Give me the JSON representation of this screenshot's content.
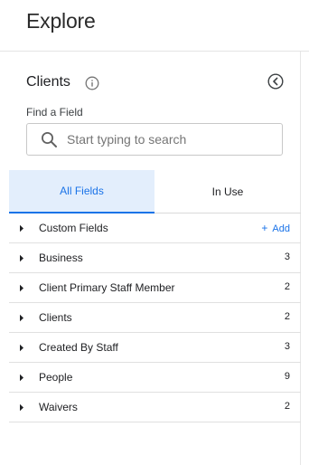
{
  "header": {
    "title": "Explore"
  },
  "panel": {
    "title": "Clients",
    "find_label": "Find a Field",
    "search": {
      "placeholder": "Start typing to search",
      "value": ""
    }
  },
  "tabs": [
    {
      "label": "All Fields",
      "active": true
    },
    {
      "label": "In Use",
      "active": false
    }
  ],
  "fields": [
    {
      "label": "Custom Fields",
      "action": "+ Add",
      "action_plus": "+",
      "action_label": "Add"
    },
    {
      "label": "Business",
      "count": "3"
    },
    {
      "label": "Client Primary Staff Member",
      "count": "2"
    },
    {
      "label": "Clients",
      "count": "2"
    },
    {
      "label": "Created By Staff",
      "count": "3"
    },
    {
      "label": "People",
      "count": "9"
    },
    {
      "label": "Waivers",
      "count": "2"
    }
  ],
  "colors": {
    "accent": "#1a73e8",
    "active_tab_bg": "#e3eefc",
    "divider": "#e0e0e0"
  },
  "icons": {
    "info": "info-icon",
    "collapse": "chevron-left-circle-icon",
    "search": "search-icon",
    "caret": "caret-right-icon"
  }
}
